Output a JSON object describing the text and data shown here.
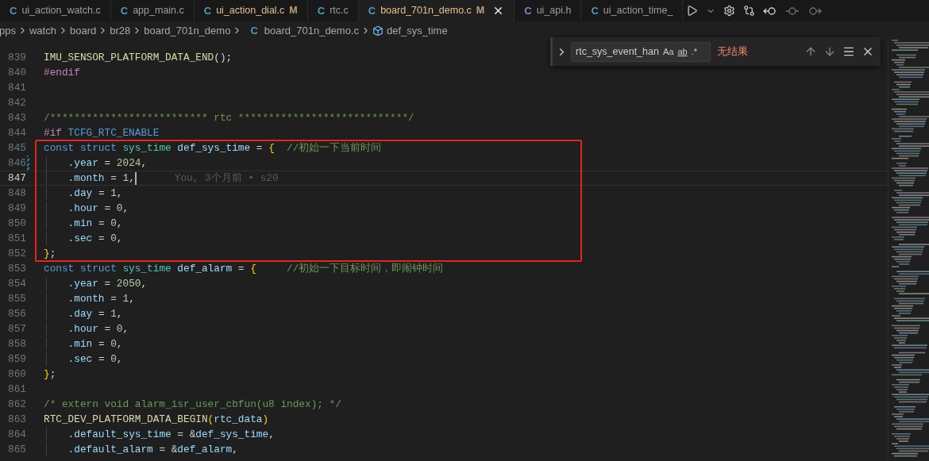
{
  "tabs": [
    {
      "icon": "C",
      "color": "#519aba",
      "label": "ui_action_watch.c",
      "selected": false
    },
    {
      "icon": "C",
      "color": "#519aba",
      "label": "app_main.c",
      "selected": false
    },
    {
      "icon": "C",
      "color": "#519aba",
      "label": "ui_action_dial.c",
      "badge": "M",
      "selected": false
    },
    {
      "icon": "C",
      "color": "#519aba",
      "label": "rtc.c",
      "selected": false
    },
    {
      "icon": "C",
      "color": "#519aba",
      "label": "board_701n_demo.c",
      "badge": "M",
      "selected": true
    },
    {
      "icon": "C",
      "color": "#a074c4",
      "label": "ui_api.h",
      "selected": false
    },
    {
      "icon": "C",
      "color": "#519aba",
      "label": "ui_action_time_",
      "selected": false
    }
  ],
  "breadcrumbs": [
    {
      "kind": "folder",
      "label": "pps"
    },
    {
      "kind": "folder",
      "label": "watch"
    },
    {
      "kind": "folder",
      "label": "board"
    },
    {
      "kind": "folder",
      "label": "br28"
    },
    {
      "kind": "folder",
      "label": "board_701n_demo"
    },
    {
      "kind": "file",
      "icon": "C",
      "label": "board_701n_demo.c"
    },
    {
      "kind": "symbol",
      "label": "def_sys_time"
    }
  ],
  "find_widget": {
    "value": "rtc_sys_event_han",
    "options": [
      "Aa",
      "ab",
      ".*"
    ],
    "result": "无结果"
  },
  "lines": [
    {
      "number": "839",
      "current": false,
      "modified": false,
      "tokens": [
        {
          "kind": "fn",
          "text": "IMU_SENSOR_PLATFORM_DATA_END"
        },
        {
          "kind": "plain",
          "text": "();"
        }
      ]
    },
    {
      "number": "840",
      "current": false,
      "modified": false,
      "tokens": [
        {
          "kind": "pre",
          "text": "#endif"
        }
      ]
    },
    {
      "number": "841",
      "current": false,
      "modified": false
    },
    {
      "number": "842",
      "current": false,
      "modified": false
    },
    {
      "number": "843",
      "current": false,
      "modified": false,
      "tokens": [
        {
          "kind": "com",
          "text": "/************************** rtc ****************************/"
        }
      ]
    },
    {
      "number": "844",
      "current": false,
      "modified": false,
      "tokens": [
        {
          "kind": "pre",
          "text": "#if "
        },
        {
          "kind": "macro",
          "text": "TCFG_RTC_ENABLE"
        }
      ]
    },
    {
      "number": "845",
      "current": false,
      "modified": false,
      "tokens": [
        {
          "kind": "kw",
          "text": "const struct "
        },
        {
          "kind": "type",
          "text": "sys_time "
        },
        {
          "kind": "var",
          "text": "def_sys_time"
        },
        {
          "kind": "plain",
          "text": " = "
        },
        {
          "kind": "brace",
          "text": "{"
        },
        {
          "kind": "com",
          "text": "  //初始一下当前时间"
        }
      ]
    },
    {
      "number": "846",
      "current": false,
      "modified": true,
      "tokens": [
        {
          "kind": "plain",
          "text": "    ."
        },
        {
          "kind": "var",
          "text": "year"
        },
        {
          "kind": "plain",
          "text": " = "
        },
        {
          "kind": "num",
          "text": "2024"
        },
        {
          "kind": "plain",
          "text": ","
        }
      ]
    },
    {
      "number": "847",
      "current": true,
      "modified": false,
      "blame": "You, 3个月前 • s20",
      "tokens": [
        {
          "kind": "plain",
          "text": "    ."
        },
        {
          "kind": "var",
          "text": "month"
        },
        {
          "kind": "plain",
          "text": " = "
        },
        {
          "kind": "num",
          "text": "1"
        },
        {
          "kind": "plain",
          "text": ","
        }
      ]
    },
    {
      "number": "848",
      "current": false,
      "modified": false,
      "tokens": [
        {
          "kind": "plain",
          "text": "    ."
        },
        {
          "kind": "var",
          "text": "day"
        },
        {
          "kind": "plain",
          "text": " = "
        },
        {
          "kind": "num",
          "text": "1"
        },
        {
          "kind": "plain",
          "text": ","
        }
      ]
    },
    {
      "number": "849",
      "current": false,
      "modified": false,
      "tokens": [
        {
          "kind": "plain",
          "text": "    ."
        },
        {
          "kind": "var",
          "text": "hour"
        },
        {
          "kind": "plain",
          "text": " = "
        },
        {
          "kind": "num",
          "text": "0"
        },
        {
          "kind": "plain",
          "text": ","
        }
      ]
    },
    {
      "number": "850",
      "current": false,
      "modified": false,
      "tokens": [
        {
          "kind": "plain",
          "text": "    ."
        },
        {
          "kind": "var",
          "text": "min"
        },
        {
          "kind": "plain",
          "text": " = "
        },
        {
          "kind": "num",
          "text": "0"
        },
        {
          "kind": "plain",
          "text": ","
        }
      ]
    },
    {
      "number": "851",
      "current": false,
      "modified": false,
      "tokens": [
        {
          "kind": "plain",
          "text": "    ."
        },
        {
          "kind": "var",
          "text": "sec"
        },
        {
          "kind": "plain",
          "text": " = "
        },
        {
          "kind": "num",
          "text": "0"
        },
        {
          "kind": "plain",
          "text": ","
        }
      ]
    },
    {
      "number": "852",
      "current": false,
      "modified": false,
      "tokens": [
        {
          "kind": "brace",
          "text": "}"
        },
        {
          "kind": "plain",
          "text": ";"
        }
      ]
    },
    {
      "number": "853",
      "current": false,
      "modified": false,
      "tokens": [
        {
          "kind": "kw",
          "text": "const struct "
        },
        {
          "kind": "type",
          "text": "sys_time "
        },
        {
          "kind": "var",
          "text": "def_alarm"
        },
        {
          "kind": "plain",
          "text": " = "
        },
        {
          "kind": "brace",
          "text": "{"
        },
        {
          "kind": "com",
          "text": "     //初始一下目标时间，即闹钟时间"
        }
      ]
    },
    {
      "number": "854",
      "current": false,
      "modified": false,
      "tokens": [
        {
          "kind": "plain",
          "text": "    ."
        },
        {
          "kind": "var",
          "text": "year"
        },
        {
          "kind": "plain",
          "text": " = "
        },
        {
          "kind": "num",
          "text": "2050"
        },
        {
          "kind": "plain",
          "text": ","
        }
      ]
    },
    {
      "number": "855",
      "current": false,
      "modified": false,
      "tokens": [
        {
          "kind": "plain",
          "text": "    ."
        },
        {
          "kind": "var",
          "text": "month"
        },
        {
          "kind": "plain",
          "text": " = "
        },
        {
          "kind": "num",
          "text": "1"
        },
        {
          "kind": "plain",
          "text": ","
        }
      ]
    },
    {
      "number": "856",
      "current": false,
      "modified": false,
      "tokens": [
        {
          "kind": "plain",
          "text": "    ."
        },
        {
          "kind": "var",
          "text": "day"
        },
        {
          "kind": "plain",
          "text": " = "
        },
        {
          "kind": "num",
          "text": "1"
        },
        {
          "kind": "plain",
          "text": ","
        }
      ]
    },
    {
      "number": "857",
      "current": false,
      "modified": false,
      "tokens": [
        {
          "kind": "plain",
          "text": "    ."
        },
        {
          "kind": "var",
          "text": "hour"
        },
        {
          "kind": "plain",
          "text": " = "
        },
        {
          "kind": "num",
          "text": "0"
        },
        {
          "kind": "plain",
          "text": ","
        }
      ]
    },
    {
      "number": "858",
      "current": false,
      "modified": false,
      "tokens": [
        {
          "kind": "plain",
          "text": "    ."
        },
        {
          "kind": "var",
          "text": "min"
        },
        {
          "kind": "plain",
          "text": " = "
        },
        {
          "kind": "num",
          "text": "0"
        },
        {
          "kind": "plain",
          "text": ","
        }
      ]
    },
    {
      "number": "859",
      "current": false,
      "modified": false,
      "tokens": [
        {
          "kind": "plain",
          "text": "    ."
        },
        {
          "kind": "var",
          "text": "sec"
        },
        {
          "kind": "plain",
          "text": " = "
        },
        {
          "kind": "num",
          "text": "0"
        },
        {
          "kind": "plain",
          "text": ","
        }
      ]
    },
    {
      "number": "860",
      "current": false,
      "modified": false,
      "tokens": [
        {
          "kind": "brace",
          "text": "}"
        },
        {
          "kind": "plain",
          "text": ";"
        }
      ]
    },
    {
      "number": "861",
      "current": false,
      "modified": false
    },
    {
      "number": "862",
      "current": false,
      "modified": false,
      "tokens": [
        {
          "kind": "com",
          "text": "/* extern void alarm_isr_user_cbfun(u8 index); */"
        }
      ]
    },
    {
      "number": "863",
      "current": false,
      "modified": false,
      "tokens": [
        {
          "kind": "fn",
          "text": "RTC_DEV_PLATFORM_DATA_BEGIN"
        },
        {
          "kind": "brace",
          "text": "("
        },
        {
          "kind": "var",
          "text": "rtc_data"
        },
        {
          "kind": "brace",
          "text": ")"
        }
      ]
    },
    {
      "number": "864",
      "current": false,
      "modified": false,
      "tokens": [
        {
          "kind": "plain",
          "text": "    ."
        },
        {
          "kind": "var",
          "text": "default_sys_time"
        },
        {
          "kind": "plain",
          "text": " = &"
        },
        {
          "kind": "var",
          "text": "def_sys_time"
        },
        {
          "kind": "plain",
          "text": ","
        }
      ]
    },
    {
      "number": "865",
      "current": false,
      "modified": false,
      "tokens": [
        {
          "kind": "plain",
          "text": "    ."
        },
        {
          "kind": "var",
          "text": "default_alarm"
        },
        {
          "kind": "plain",
          "text": " = &"
        },
        {
          "kind": "var",
          "text": "def_alarm"
        },
        {
          "kind": "plain",
          "text": ","
        }
      ]
    }
  ]
}
